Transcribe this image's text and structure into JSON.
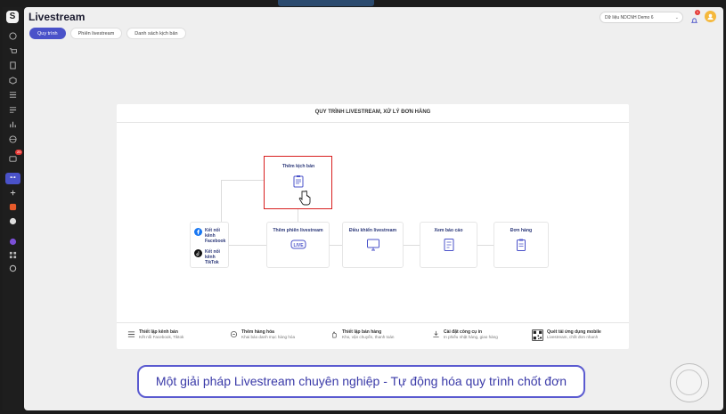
{
  "app": {
    "title": "Livestream"
  },
  "tabs": [
    {
      "label": "Quy trình",
      "active": true
    },
    {
      "label": "Phiên livestream",
      "active": false
    },
    {
      "label": "Danh sách kịch bản",
      "active": false
    }
  ],
  "header": {
    "account_label": "Dữ liệu NDCNH Demo 6",
    "notification_count": "1"
  },
  "sidebar": {
    "logo": "S",
    "active_item": "•-•",
    "badge": "20"
  },
  "process": {
    "title": "QUY TRÌNH LIVESTREAM, XỬ LÝ ĐƠN HÀNG",
    "steps": {
      "add_script": "Thêm kịch bản",
      "add_session": "Thêm phiên livestream",
      "control": "Điều khiển livestream",
      "report": "Xem báo cáo",
      "orders": "Đơn hàng"
    },
    "connect": {
      "facebook": "Kết nối kênh Facebook",
      "tiktok": "Kết nối kênh TikTok"
    }
  },
  "features": [
    {
      "title": "Thiết lập kênh bán",
      "desc": "Kết nối Facebook, Tiktok",
      "icon": "list-icon"
    },
    {
      "title": "Thêm hàng hóa",
      "desc": "Khai báo danh mục hàng hóa",
      "icon": "box-icon"
    },
    {
      "title": "Thiết lập bán hàng",
      "desc": "Kho, vận chuyển, thanh toán",
      "icon": "hand-icon"
    },
    {
      "title": "Cài đặt công cụ in",
      "desc": "In phiếu nhặt hàng, giao hàng",
      "icon": "download-icon"
    },
    {
      "title": "Quét tải ứng dụng mobile",
      "desc": "Livestream, chốt đơn nhanh",
      "icon": "qr-icon"
    }
  ],
  "banner": {
    "text": "Một giải pháp Livestream chuyên nghiệp - Tự động hóa quy trình chốt đơn"
  },
  "colors": {
    "accent": "#4a52c9",
    "highlight": "#d81f1f",
    "banner_border": "#5a5ad0"
  }
}
